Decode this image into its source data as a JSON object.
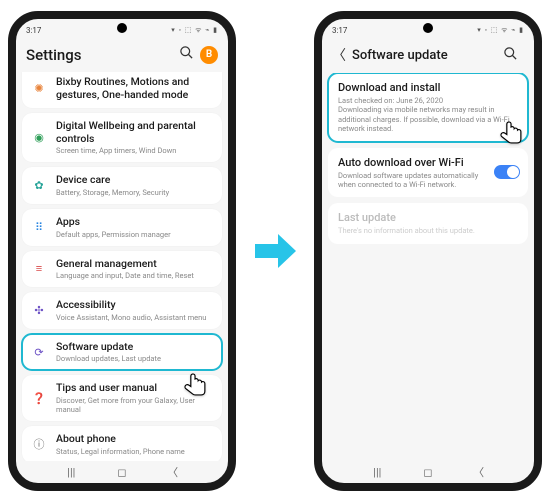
{
  "status": {
    "time": "3:17",
    "icons": "▾ ◦ ⬚ ᯤ ⌁ ▮"
  },
  "leftPhone": {
    "headerTitle": "Settings",
    "avatarLetter": "B",
    "items": [
      {
        "title": "Bixby Routines, Motions and gestures, One-handed mode",
        "sub": "",
        "icon": "✺",
        "iconClass": "ic-orange",
        "partialTop": true
      },
      {
        "title": "Digital Wellbeing and parental controls",
        "sub": "Screen time, App timers, Wind Down",
        "icon": "◉",
        "iconClass": "ic-green"
      },
      {
        "title": "Device care",
        "sub": "Battery, Storage, Memory, Security",
        "icon": "✿",
        "iconClass": "ic-teal"
      },
      {
        "title": "Apps",
        "sub": "Default apps, Permission manager",
        "icon": "⠿",
        "iconClass": "ic-blue"
      },
      {
        "title": "General management",
        "sub": "Language and input, Date and time, Reset",
        "icon": "≡",
        "iconClass": "ic-red"
      },
      {
        "title": "Accessibility",
        "sub": "Voice Assistant, Mono audio, Assistant menu",
        "icon": "✣",
        "iconClass": "ic-purple"
      },
      {
        "title": "Software update",
        "sub": "Download updates, Last update",
        "icon": "⟳",
        "iconClass": "ic-purple",
        "highlight": true
      },
      {
        "title": "Tips and user manual",
        "sub": "Discover, Get more from your Galaxy, User manual",
        "icon": "❓",
        "iconClass": "ic-yellow"
      },
      {
        "title": "About phone",
        "sub": "Status, Legal information, Phone name",
        "icon": "ⓘ",
        "iconClass": "ic-grey"
      }
    ]
  },
  "rightPhone": {
    "headerTitle": "Software update",
    "cards": {
      "download": {
        "title": "Download and install",
        "sub": "Last checked on: June 26, 2020\nDownloading via mobile networks may result in additional charges. If possible, download via a Wi-Fi network instead."
      },
      "auto": {
        "title": "Auto download over Wi-Fi",
        "sub": "Download software updates automatically when connected to a Wi-Fi network."
      },
      "last": {
        "title": "Last update",
        "sub": "There's no information about this update."
      }
    }
  }
}
